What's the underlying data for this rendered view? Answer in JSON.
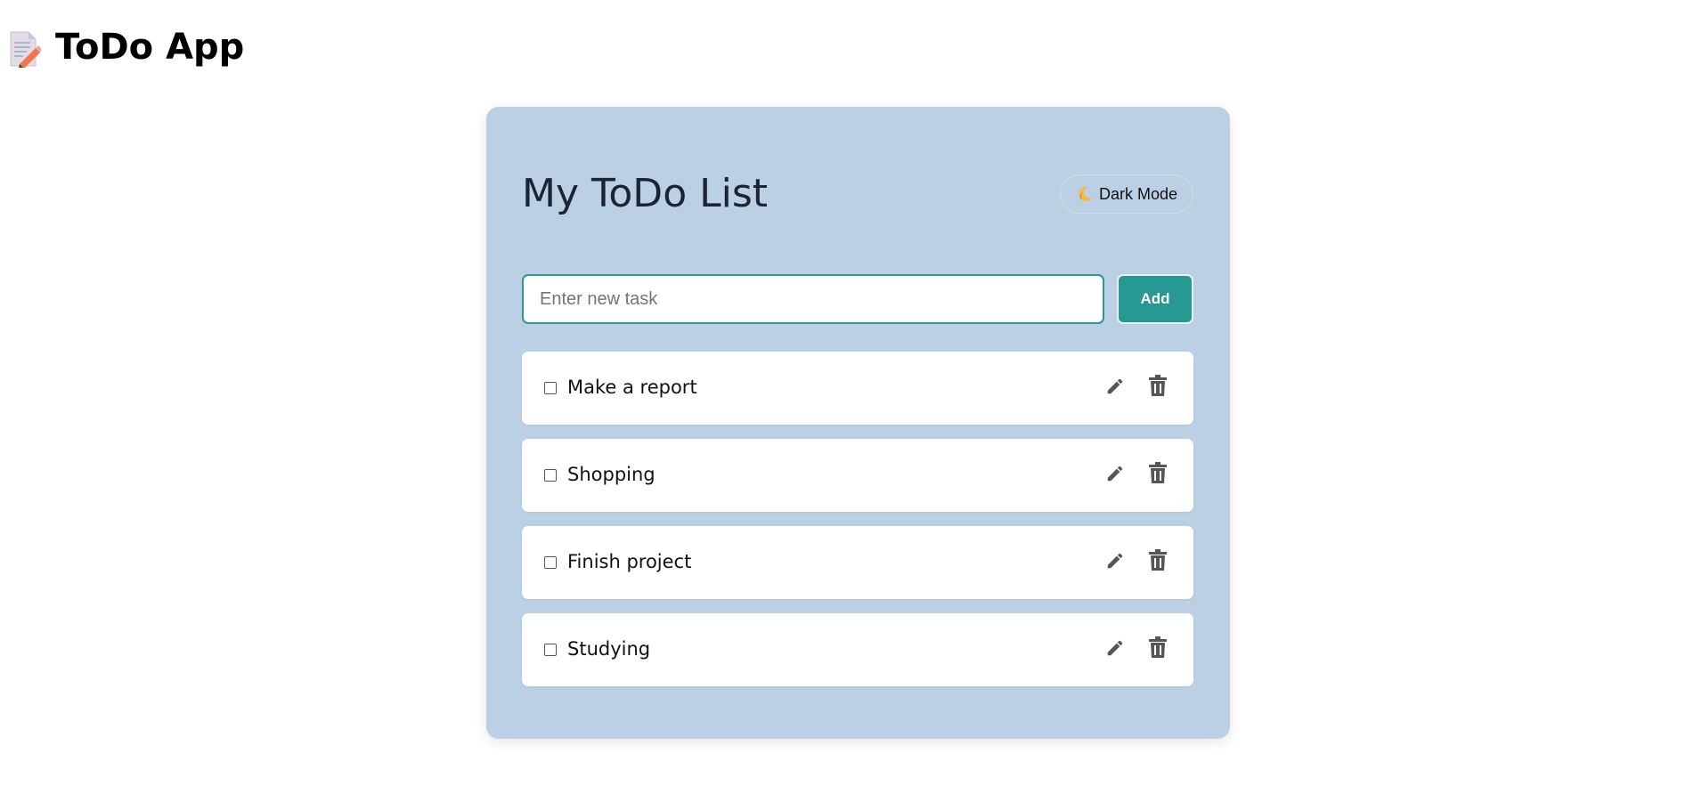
{
  "app": {
    "title": "ToDo App",
    "logo_icon": "memo-pencil-icon"
  },
  "card": {
    "title": "My ToDo List",
    "background": "#bbd0e4",
    "dark_mode_label": "Dark Mode",
    "dark_mode_icon": "moon-icon"
  },
  "form": {
    "placeholder": "Enter new task",
    "value": "",
    "add_label": "Add",
    "accent": "#279893"
  },
  "tasks": [
    {
      "text": "Make a report",
      "done": false
    },
    {
      "text": "Shopping",
      "done": false
    },
    {
      "text": "Finish project",
      "done": false
    },
    {
      "text": "Studying",
      "done": false
    }
  ],
  "icons": {
    "edit": "pencil-icon",
    "delete": "trash-icon"
  }
}
